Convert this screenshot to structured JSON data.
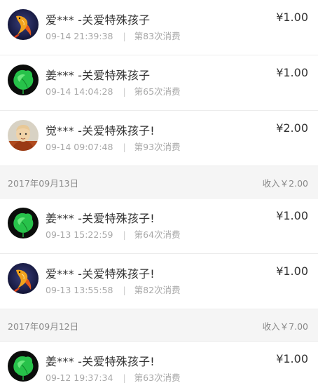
{
  "records": [
    {
      "type": "item",
      "avatar": "koi-fish-avatar",
      "title": "爱*** -关爱特殊孩子",
      "time": "09-14 21:39:38",
      "sep": "|",
      "count": "第83次消费",
      "amount": "¥1.00"
    },
    {
      "type": "item",
      "avatar": "green-leaf-avatar",
      "title": "姜*** -关爱特殊孩子",
      "time": "09-14 14:04:28",
      "sep": "|",
      "count": "第65次消费",
      "amount": "¥1.00"
    },
    {
      "type": "item",
      "avatar": "portrait-avatar",
      "title": "觉*** -关爱特殊孩子!",
      "time": "09-14 09:07:48",
      "sep": "|",
      "count": "第93次消费",
      "amount": "¥2.00"
    },
    {
      "type": "date",
      "date": "2017年09月13日",
      "income": "收入￥2.00"
    },
    {
      "type": "item",
      "avatar": "green-leaf-avatar",
      "title": "姜*** -关爱特殊孩子!",
      "time": "09-13 15:22:59",
      "sep": "|",
      "count": "第64次消费",
      "amount": "¥1.00"
    },
    {
      "type": "item",
      "avatar": "koi-fish-avatar",
      "title": "爱*** -关爱特殊孩子!",
      "time": "09-13 13:55:58",
      "sep": "|",
      "count": "第82次消费",
      "amount": "¥1.00"
    },
    {
      "type": "date",
      "date": "2017年09月12日",
      "income": "收入￥7.00"
    },
    {
      "type": "item",
      "avatar": "green-leaf-avatar",
      "title": "姜*** -关爱特殊孩子!",
      "time": "09-12 19:37:34",
      "sep": "|",
      "count": "第63次消费",
      "amount": "¥1.00"
    }
  ],
  "colors": {
    "title": "#333333",
    "meta": "#a8a8a8",
    "header_bg": "#f5f5f5",
    "divider": "#ececec"
  }
}
